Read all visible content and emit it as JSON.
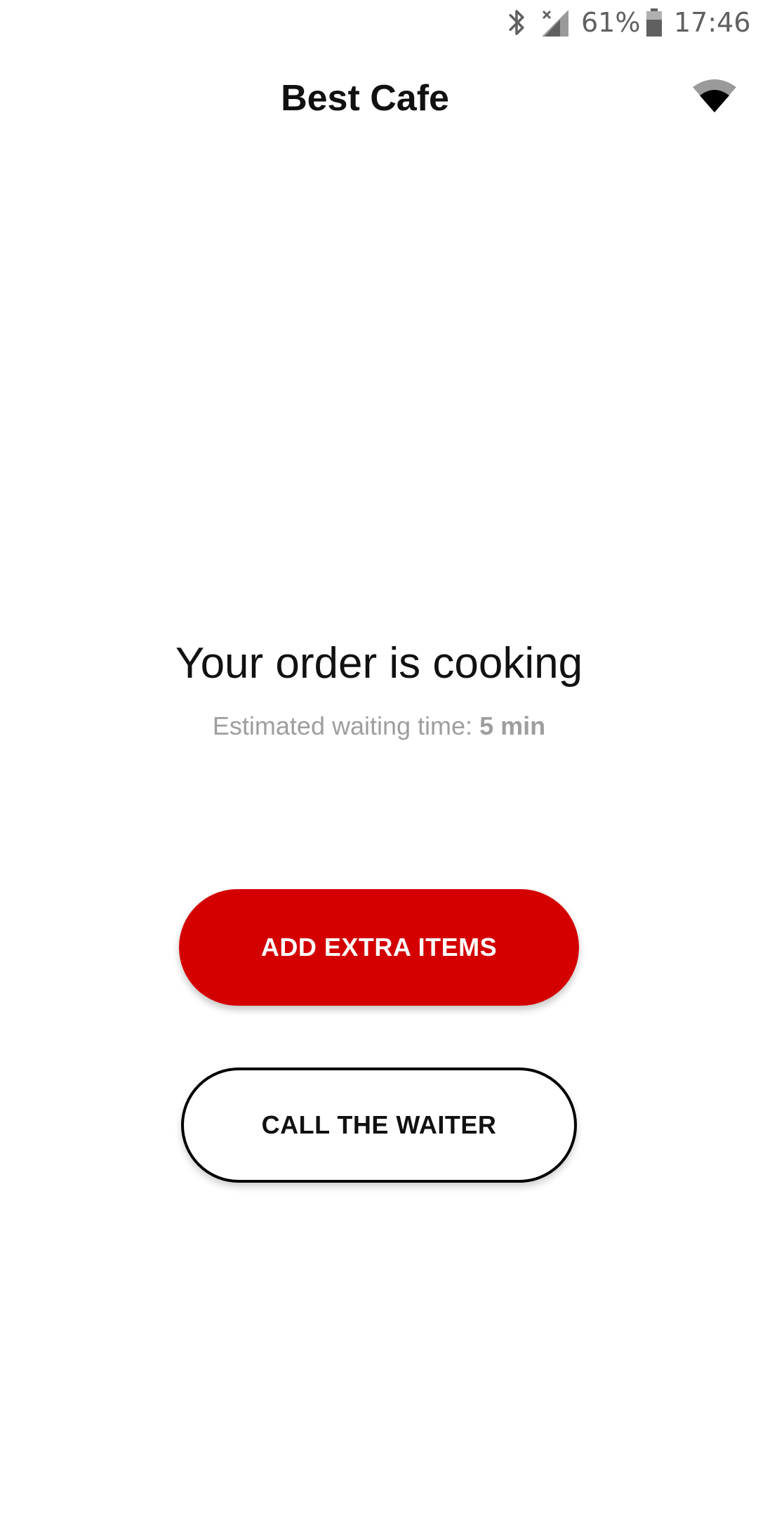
{
  "status_bar": {
    "battery_percent": "61%",
    "time": "17:46",
    "icons": [
      "bluetooth-icon",
      "signal-icon",
      "battery-icon"
    ]
  },
  "header": {
    "title": "Best Cafe",
    "icon": "wifi-icon"
  },
  "order_status": {
    "title": "Your order is cooking",
    "eta_label": "Estimated waiting time:",
    "eta_value": "5 min"
  },
  "actions": {
    "add_extra_label": "ADD EXTRA ITEMS",
    "call_waiter_label": "CALL THE WAITER"
  },
  "colors": {
    "accent": "#d40000",
    "muted_text": "#9e9e9e"
  }
}
